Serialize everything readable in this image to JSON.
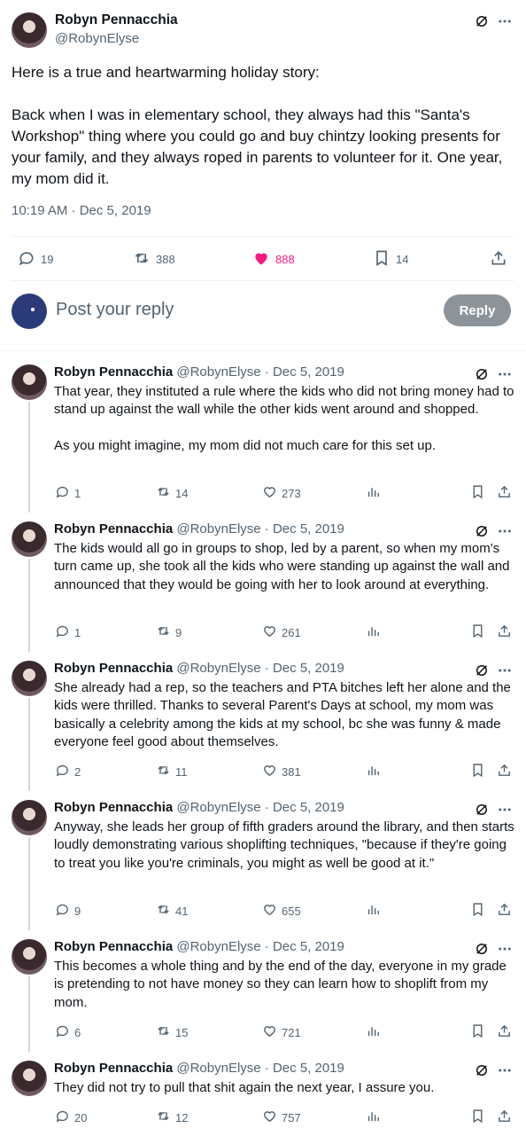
{
  "tweet": {
    "author_name": "Robyn Pennacchia",
    "author_handle": "@RobynElyse",
    "text": "Here is a true and heartwarming holiday story:\n\nBack when I was in elementary school, they always had this \"Santa's Workshop\" thing where you could go and buy chintzy looking presents for your family, and they always roped in parents to volunteer for it. One year, my mom did it.",
    "timestamp": "10:19 AM · Dec 5, 2019",
    "replies": "19",
    "retweets": "388",
    "likes": "888",
    "bookmarks": "14",
    "like_color": "#f91880"
  },
  "reply_box": {
    "placeholder": "Post your reply",
    "button_label": "Reply"
  },
  "thread": [
    {
      "name": "Robyn Pennacchia",
      "meta": "@RobynElyse · Dec 5, 2019",
      "text": "That year, they instituted a rule where the kids who did not bring money had to stand up against the wall while the other kids went around and shopped.\n\nAs you might imagine, my mom did not much care for this set up.",
      "replies": "1",
      "retweets": "14",
      "likes": "273"
    },
    {
      "name": "Robyn Pennacchia",
      "meta": "@RobynElyse · Dec 5, 2019",
      "text": "The kids would all go in groups to shop, led by a parent, so when my mom's turn came up, she took all the kids who were standing up against the wall and announced that they would be going with her to look around at everything.",
      "replies": "1",
      "retweets": "9",
      "likes": "261"
    },
    {
      "name": "Robyn Pennacchia",
      "meta": "@RobynElyse · Dec 5, 2019",
      "text": "She already had a rep, so the teachers and PTA bitches left her alone and the kids were thrilled. Thanks to several Parent's Days at school, my mom was basically a celebrity among the kids at my school, bc she was funny & made everyone feel good about themselves.",
      "replies": "2",
      "retweets": "11",
      "likes": "381"
    },
    {
      "name": "Robyn Pennacchia",
      "meta": "@RobynElyse · Dec 5, 2019",
      "text": "Anyway, she leads her group of fifth graders around the library, and then starts loudly demonstrating various shoplifting techniques, \"because if they're going to treat you like you're criminals, you might as well be good at it.\"",
      "replies": "9",
      "retweets": "41",
      "likes": "655"
    },
    {
      "name": "Robyn Pennacchia",
      "meta": "@RobynElyse · Dec 5, 2019",
      "text": "This becomes a whole thing and by the end of the day, everyone in my grade is pretending to not have money so they can learn how to shoplift from my mom.",
      "replies": "6",
      "retweets": "15",
      "likes": "721"
    },
    {
      "name": "Robyn Pennacchia",
      "meta": "@RobynElyse · Dec 5, 2019",
      "text": "They did not try to pull that shit again the next year, I assure you.",
      "replies": "20",
      "retweets": "12",
      "likes": "757"
    }
  ]
}
